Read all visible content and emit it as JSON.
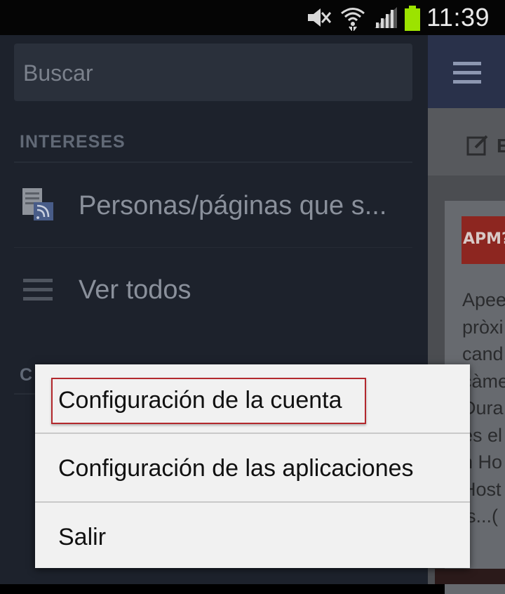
{
  "status_bar": {
    "time": "11:39",
    "icons": [
      "mute-icon",
      "wifi-icon",
      "signal-icon",
      "battery-icon"
    ],
    "battery_color": "#9ce300"
  },
  "side_menu": {
    "search": {
      "placeholder": "Buscar"
    },
    "sections": [
      {
        "header": "INTERESES",
        "items": [
          {
            "label": "Personas/páginas que s...",
            "icon": "pages-feed-icon"
          },
          {
            "label": "Ver todos",
            "icon": "list-icon"
          }
        ]
      },
      {
        "header": "C"
      }
    ]
  },
  "feed": {
    "menu_icon": "hamburger-menu-icon",
    "subbar_icon": "edit-status-icon",
    "subbar_text": "E",
    "thumb_text": "APM?",
    "text_lines": [
      "Apee",
      "pròxi",
      "cand",
      "càme",
      "Dura",
      "es el",
      "n Ho",
      "Host",
      "ls...("
    ]
  },
  "popup_menu": {
    "items": [
      {
        "label": "Configuración de la cuenta",
        "highlighted": true
      },
      {
        "label": "Configuración de las aplicaciones"
      },
      {
        "label": "Salir"
      }
    ],
    "highlight_color": "#b3282d"
  }
}
